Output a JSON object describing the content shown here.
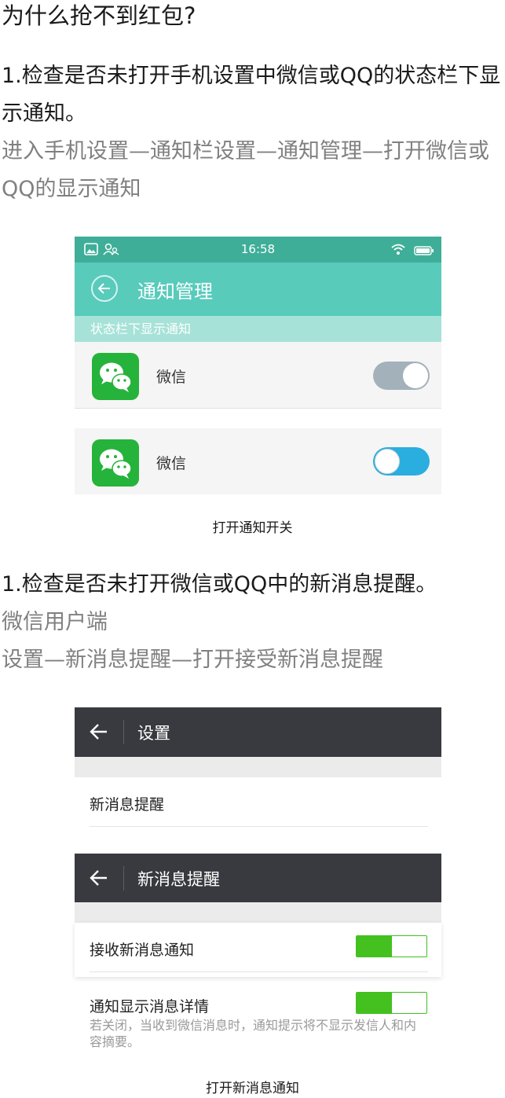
{
  "title": "为什么抢不到红包?",
  "section1": {
    "heading": "1.检查是否未打开手机设置中微信或QQ的状态栏下显示通知。",
    "path": "进入手机设置—通知栏设置—通知管理—打开微信或QQ的显示通知",
    "shot": {
      "time": "16:58",
      "app_title": "通知管理",
      "section_header": "状态栏下显示通知",
      "row_label": "微信",
      "toggle_off_state": "off",
      "toggle_on_state": "on"
    },
    "row2_label": "微信",
    "caption": "打开通知开关"
  },
  "section2": {
    "heading": "1.检查是否未打开微信或QQ中的新消息提醒。",
    "line1": "微信用户端",
    "line2": "设置—新消息提醒—打开接受新消息提醒",
    "screen1": {
      "title": "设置",
      "item": "新消息提醒"
    },
    "screen2": {
      "title": "新消息提醒",
      "item1": "接收新消息通知",
      "item2": "通知显示消息详情",
      "note": "若关闭，当收到微信消息时，通知提示将不显示发信人和内容摘要。"
    },
    "caption": "打开新消息通知"
  },
  "colors": {
    "status_bar": "#3fae98",
    "app_bar": "#58cbbb",
    "toggle_on_blue": "#2aaee0",
    "wechat_green": "#44c11f",
    "dark_bar": "#393a3f"
  }
}
